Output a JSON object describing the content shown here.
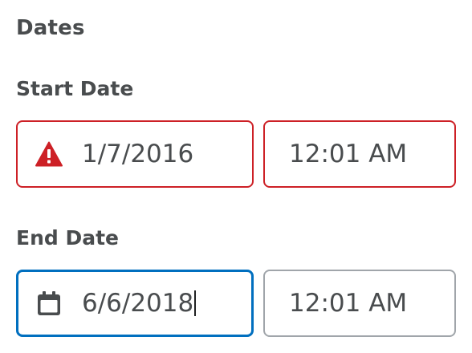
{
  "section": {
    "title": "Dates"
  },
  "start_date": {
    "label": "Start Date",
    "date_value": "1/7/2016",
    "time_value": "12:01 AM",
    "date_icon": "warning-icon",
    "state": "error"
  },
  "end_date": {
    "label": "End Date",
    "date_value": "6/6/2018",
    "time_value": "12:01 AM",
    "date_icon": "calendar-icon",
    "state": "focused"
  },
  "colors": {
    "text": "#494c4e",
    "error": "#cd2026",
    "focus": "#006fbf",
    "border": "#a0a5aa"
  }
}
